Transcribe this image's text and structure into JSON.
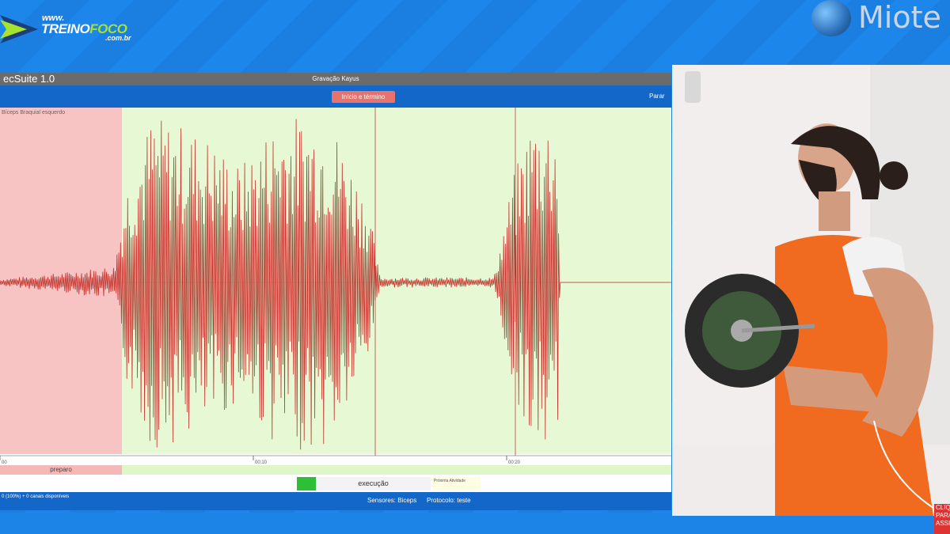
{
  "branding": {
    "www": "www.",
    "treino": "TREINO",
    "foco": "FOCO",
    "com": ".com.br",
    "partner": "Miote"
  },
  "app": {
    "name": "ecSuite 1.0",
    "recording_title": "Gravação Kayus",
    "start_button": "Início e término",
    "stop_button": "Parar",
    "channel": "Bíceps Braquial esquerdo",
    "time_ticks": [
      "00",
      "00:10",
      "00:20"
    ],
    "phase_preparo": "preparo",
    "phase_execucao": "execução",
    "next_activity": "Próxima Atividade",
    "footer_status": "0 (100%) + 0 canais disponíveis",
    "sensors": "Sensores: Biceps",
    "protocol": "Protocolo: teste",
    "colors": {
      "prep_zone": "#f8c4c3",
      "exec_zone": "#e7f9d4",
      "signal": "#c0302a",
      "toolbar": "#1267c9",
      "start_button": "#e8726d"
    }
  },
  "chart_data": {
    "type": "line",
    "title": "",
    "xlabel": "",
    "ylabel": "",
    "x_ticks": [
      "00",
      "00:10",
      "00:20"
    ],
    "series": [
      {
        "name": "Bíceps Braquial esquerdo",
        "envelope": [
          {
            "t": 0,
            "amp": 0.02
          },
          {
            "t": 2.5,
            "amp": 0.06
          },
          {
            "t": 4.5,
            "amp": 0.1
          },
          {
            "t": 5.0,
            "amp": 0.6
          },
          {
            "t": 6.0,
            "amp": 1.0
          },
          {
            "t": 8.0,
            "amp": 0.9
          },
          {
            "t": 9.5,
            "amp": 0.7
          },
          {
            "t": 11.0,
            "amp": 1.0
          },
          {
            "t": 13.0,
            "amp": 1.0
          },
          {
            "t": 14.5,
            "amp": 0.5
          },
          {
            "t": 15.0,
            "amp": 0.03
          },
          {
            "t": 19.5,
            "amp": 0.03
          },
          {
            "t": 20.2,
            "amp": 0.6
          },
          {
            "t": 21.0,
            "amp": 1.0
          },
          {
            "t": 22.0,
            "amp": 1.0
          },
          {
            "t": 22.1,
            "amp": 0
          }
        ]
      }
    ],
    "xlim": [
      0,
      26.5
    ],
    "ylim": [
      -1,
      1
    ]
  },
  "caption": {
    "clique": "CLIQ PARA ASSI"
  }
}
